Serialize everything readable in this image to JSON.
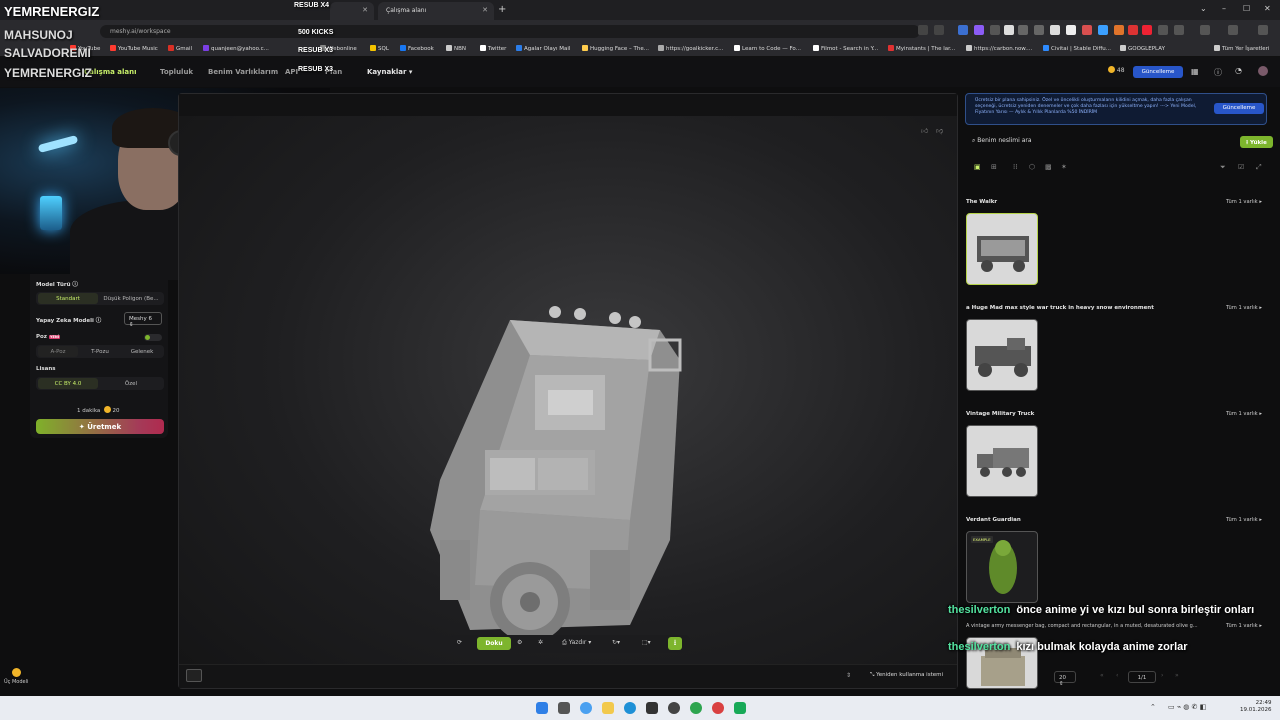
{
  "browser": {
    "tabs": [
      {
        "label": ""
      },
      {
        "label": "Çalışma alanı"
      }
    ],
    "url": "meshy.ai/workspace",
    "bookmarks": [
      "YouTube",
      "YouTube Music",
      "Gmail",
      "quanjeen@yahoo.c...",
      "Webonline",
      "SQL",
      "Facebook",
      "NBN",
      "Twitter",
      "Agalar Olayı Mail",
      "Hugging Face – The...",
      "https://goalkicker.c...",
      "Learn to Code — Fo...",
      "Filmot - Search in Y...",
      "Myinstants | The lar...",
      "https://carbon.now....",
      "Civitai | Stable Diffu...",
      "GOOGLEPLAY",
      "Tüm Yer İşaretleri"
    ],
    "bookmark_colors": [
      "#ff3b30",
      "#ff3b30",
      "#d93025",
      "#7b3fe4",
      "#888888",
      "#f5c400",
      "#1877f2",
      "#cccccc",
      "#ffffff",
      "#2b7de9",
      "#ffcc4d",
      "#aaaaaa",
      "#ffffff",
      "#ffffff",
      "#e03131",
      "#cccccc",
      "#2e8bff",
      "#cccccc",
      "#cccccc"
    ]
  },
  "app": {
    "nav": [
      "Çalışma alanı",
      "Topluluk",
      "Benim Varlıklarım",
      "API",
      "Plan",
      "Kaynaklar"
    ],
    "credits": "48",
    "upgrade": "Güncelleme"
  },
  "overlay": {
    "name1": "YEMRENERGIZ",
    "name2": "MAHSUNOJ",
    "name3": "SALVADOREMI",
    "name4": "YEMRENERGIZ",
    "resub1": "RESUB X4",
    "kicks": "500 KICKS",
    "resub2": "RESUB X3",
    "resub3": "RESUB X3"
  },
  "left": {
    "model_type_label": "Model Türü",
    "model_types": [
      "Standart",
      "Düşük Poligon (Be..."
    ],
    "ai_model_label": "Yapay Zeka Modeli",
    "ai_model_value": "Meshy 6",
    "pose_label": "Poz",
    "pose_badge": "YENİ",
    "poses": [
      "A-Poz",
      "T-Pozu",
      "Gelenek"
    ],
    "license_label": "Lisans",
    "licenses": [
      "CC BY 4.0",
      "Özel"
    ],
    "time": "1 dakika",
    "cost": "20",
    "generate": "Üretmek"
  },
  "viewer": {
    "toolbar": {
      "texture": "Doku",
      "print": "Yazdır"
    },
    "reuse": "Yeniden kullanma istemi"
  },
  "right": {
    "promo": "Ücretsiz bir plana sahipsiniz. Özel ve öncelikli oluşturmaların kilidini açmak, daha fazla çalışan seçeneği, ücretsiz yeniden denemeler ve çok daha fazlası için yükseltme yapın! ---> Yeni Model, Fiyatının Yarısı — Aylık & Yıllık Planlarda %50 İNDİRİM",
    "promo_button": "Güncelleme",
    "search_placeholder": "Benim neslimi ara",
    "upload": "Yükle",
    "items": [
      {
        "title": "The Walkr",
        "visibility": "Tüm 1 varlık"
      },
      {
        "title": "a Huge Mad max style war truck in heavy snow environment",
        "visibility": "Tüm 1 varlık"
      },
      {
        "title": "Vintage Military Truck",
        "visibility": "Tüm 1 varlık"
      },
      {
        "title": "Verdant Guardian",
        "visibility": "Tüm 1 varlık",
        "badge": "EXAMPLE"
      },
      {
        "title": "A vintage army messenger bag, compact and rectangular, in a muted, desaturated olive g...",
        "visibility": "Tüm 1 varlık"
      }
    ],
    "page_size": "20",
    "page": "1/1"
  },
  "chat": [
    {
      "user": "thesilverton",
      "text": "önce anime yi ve kızı bul sonra birleştir onları"
    },
    {
      "user": "thesilverton",
      "text": "kızı bulmak kolayda anime zorlar"
    }
  ],
  "taskbar": {
    "time": "22:49",
    "date": "19.01.2026"
  },
  "bottom_left": "Üç Modeli"
}
